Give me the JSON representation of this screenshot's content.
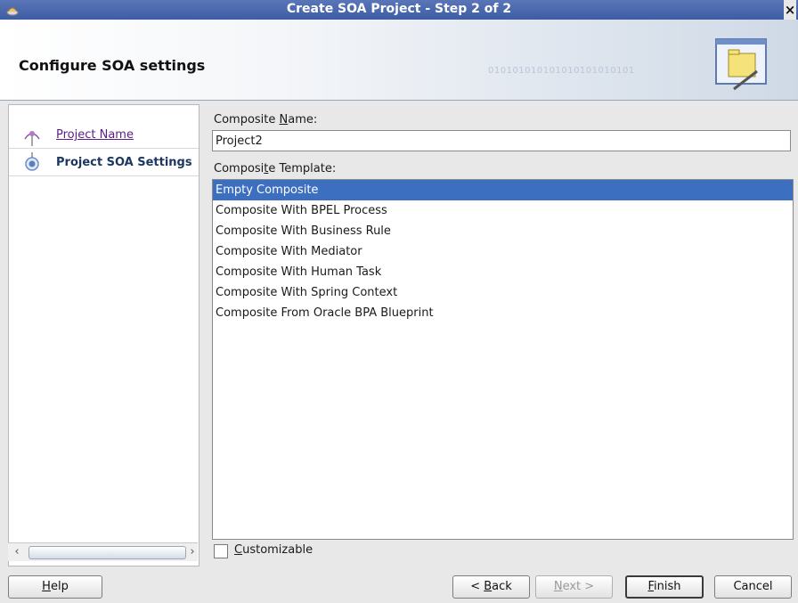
{
  "window": {
    "title": "Create SOA Project - Step 2 of 2",
    "close_glyph": "×"
  },
  "banner": {
    "heading": "Configure SOA settings",
    "binary_text": "010101010101010101010101"
  },
  "nav": {
    "items": [
      {
        "label": "Project Name",
        "state": "visited"
      },
      {
        "label": "Project SOA Settings",
        "state": "current"
      }
    ]
  },
  "form": {
    "composite_name": {
      "label_pre": "Composite ",
      "label_mnemonic": "N",
      "label_post": "ame:",
      "value": "Project2"
    },
    "composite_template": {
      "label_pre": "Composi",
      "label_mnemonic": "t",
      "label_post": "e Template:",
      "options": [
        "Empty Composite",
        "Composite With BPEL Process",
        "Composite With Business Rule",
        "Composite With Mediator",
        "Composite With Human Task",
        "Composite With Spring Context",
        "Composite From Oracle BPA Blueprint"
      ],
      "selected": "Empty Composite"
    },
    "customizable": {
      "label_mnemonic": "C",
      "label_post": "ustomizable",
      "checked": false
    }
  },
  "buttons": {
    "help": {
      "mnemonic": "H",
      "rest": "elp"
    },
    "back": {
      "pre": "< ",
      "mnemonic": "B",
      "rest": "ack"
    },
    "next": {
      "mnemonic": "N",
      "rest": "ext >"
    },
    "finish": {
      "mnemonic": "F",
      "rest": "inish"
    },
    "cancel": {
      "label": "Cancel"
    }
  },
  "colors": {
    "titlebar": "#3d5ca3",
    "selection": "#3c6fc0",
    "link": "#5a1d8a"
  }
}
